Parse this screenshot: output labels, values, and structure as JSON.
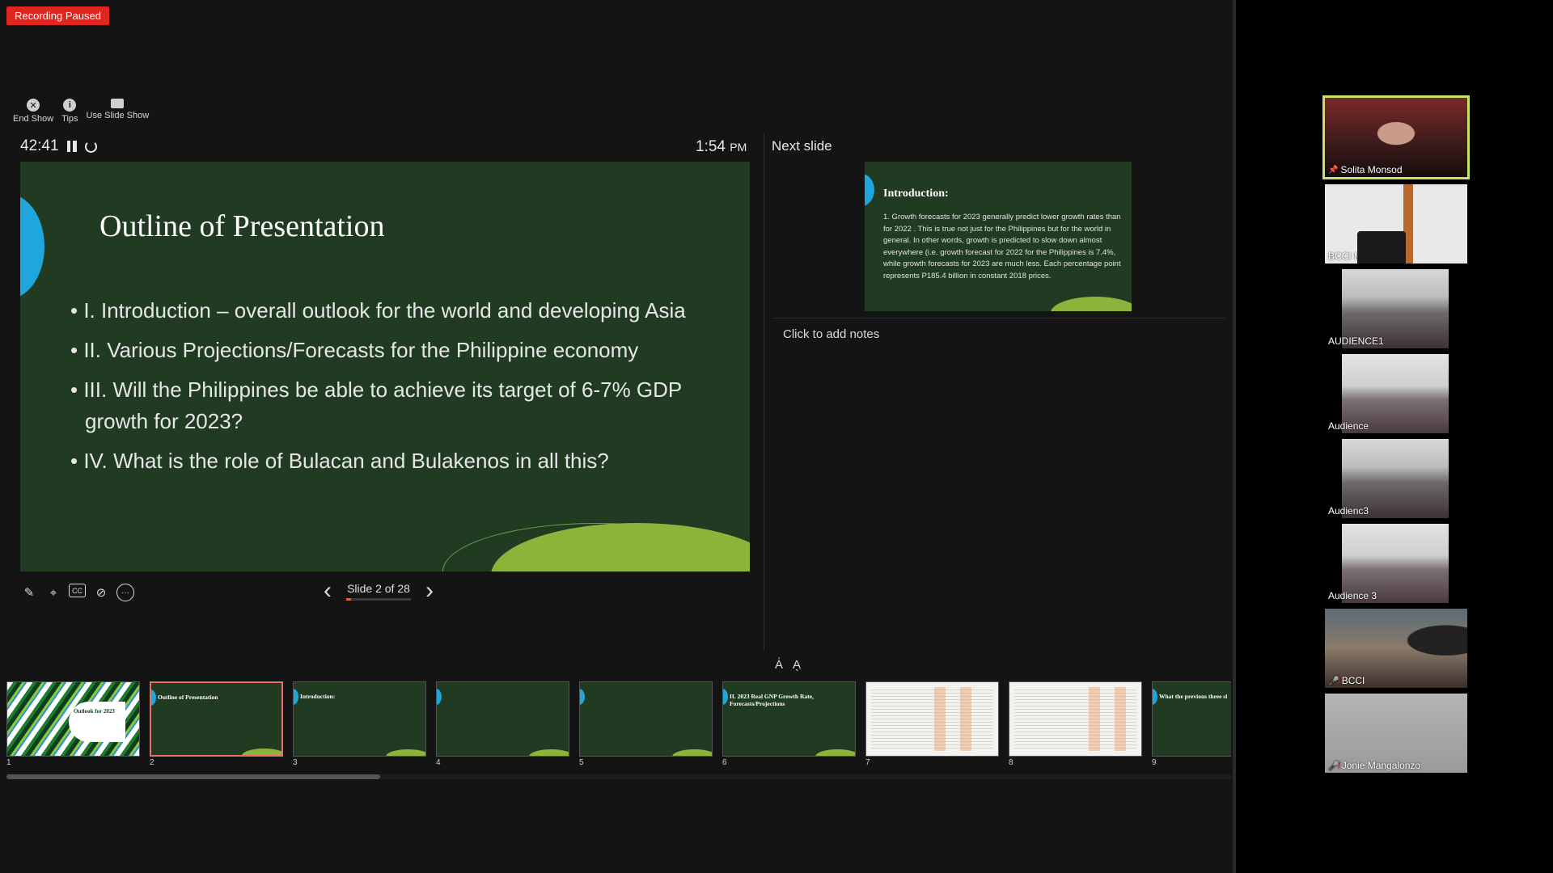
{
  "recording": {
    "label": "Recording Paused"
  },
  "toolbar": {
    "items": [
      {
        "label": "End Show",
        "icon": "close-circle-icon"
      },
      {
        "label": "Tips",
        "icon": "info-icon"
      },
      {
        "label": "Use Slide Show",
        "icon": "slideshow-icon"
      }
    ]
  },
  "timer": {
    "elapsed": "42:41",
    "clock": "1:54",
    "clock_suffix": "PM"
  },
  "current_slide": {
    "title": "Outline of Presentation",
    "bullets": [
      "I.  Introduction –  overall outlook for the world and developing Asia",
      "II. Various Projections/Forecasts for the Philippine economy",
      "III.  Will the Philippines be able to achieve its target of 6-7% GDP growth for 2023?",
      "IV.  What is the role of Bulacan and Bulakenos in all this?"
    ]
  },
  "navigation": {
    "counter": "Slide 2 of 28",
    "current": 2,
    "total": 28
  },
  "next_slide": {
    "label": "Next slide",
    "title": "Introduction:",
    "body": "1.  Growth forecasts for 2023 generally predict lower growth rates than for 2022 .  This is true not just for the Philippines but for the world in general.   In other words, growth is predicted to slow down almost everywhere  (i.e. growth forecast for 2022 for the Philippines is 7.4%, while growth forecasts for 2023 are much less.  Each percentage point represents P185.4 billion in constant 2018 prices."
  },
  "notes": {
    "placeholder": "Click to add notes"
  },
  "thumbnails": [
    {
      "num": "1",
      "title": "Outlook for 2023"
    },
    {
      "num": "2",
      "title": "Outline of Presentation"
    },
    {
      "num": "3",
      "title": "Introduction:"
    },
    {
      "num": "4",
      "title": ""
    },
    {
      "num": "5",
      "title": ""
    },
    {
      "num": "6",
      "title": "II.  2023 Real GNP Growth Rate, Forecasts/Projections"
    },
    {
      "num": "7",
      "title": ""
    },
    {
      "num": "8",
      "title": ""
    },
    {
      "num": "9",
      "title": "What the previous three sl"
    }
  ],
  "participants": [
    {
      "name": "Solita Monsod",
      "active": true,
      "pinned": true,
      "muted": false
    },
    {
      "name": "BCCI Main",
      "active": false,
      "pinned": false,
      "muted": false
    },
    {
      "name": "AUDIENCE1",
      "active": false,
      "pinned": false,
      "muted": false
    },
    {
      "name": "Audience",
      "active": false,
      "pinned": false,
      "muted": false
    },
    {
      "name": "Audienc3",
      "active": false,
      "pinned": false,
      "muted": false
    },
    {
      "name": "Audience 3",
      "active": false,
      "pinned": false,
      "muted": false
    },
    {
      "name": "BCCI",
      "active": false,
      "pinned": false,
      "muted": true
    },
    {
      "name": "Jonie Mangalonzo",
      "active": false,
      "pinned": false,
      "muted": true
    }
  ],
  "colors": {
    "slide_bg": "#213b22",
    "accent_blue": "#1fa6dc",
    "accent_green": "#8db33a",
    "active_speaker": "#c7e564",
    "recording": "#e0261f"
  }
}
